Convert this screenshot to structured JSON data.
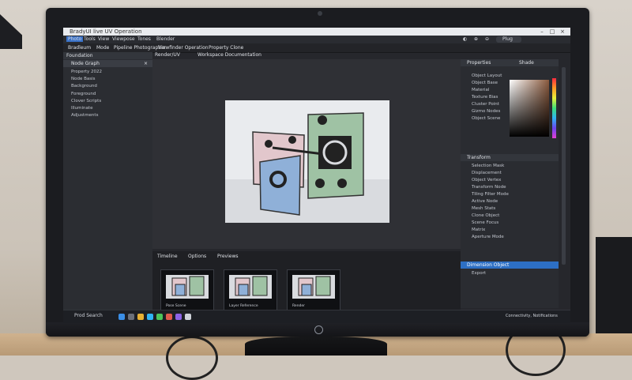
{
  "window": {
    "title": "BradyUI live UV Operation",
    "controls": [
      "–",
      "□",
      "×"
    ]
  },
  "menu": {
    "items": [
      "Photo",
      "Tools",
      "View",
      "Viewpose",
      "Tones",
      "Blender"
    ],
    "right_pills": [
      "◐",
      "⊕",
      "⊖",
      "Plug"
    ]
  },
  "toolbar": {
    "left_a": "Bradleum",
    "left_b": "Mode",
    "left_c": "Pipeline Photographer",
    "center_a": "Viewfinder Operation",
    "center_b": "Property Clone"
  },
  "left_panel": {
    "tab": "Foundation",
    "header": "Node Graph",
    "tree": [
      "Property 2022",
      "Node Basis",
      "Background",
      "Foreground",
      "Clover Scripts",
      "Illuminate",
      "Adjustments"
    ]
  },
  "viewport": {
    "tabs": [
      "Render/UV",
      "Workspace Documentation"
    ]
  },
  "thumbs": {
    "tabs": [
      "Timeline",
      "Options",
      "Previews"
    ],
    "items": [
      "Pose Scene",
      "Layer Reference",
      "Render"
    ]
  },
  "right_panel": {
    "header": "Properties",
    "color_tab": "Shade",
    "list": [
      "Object Layout",
      "Object Base",
      "Material",
      "Texture Bias",
      "Cluster Point",
      "Gizmo Nodes",
      "Object Scene"
    ],
    "lower_header": "Transform",
    "lower_list": [
      "Selection Mask",
      "Displacement",
      "Object Vertex",
      "Transform Node",
      "Tiling Filter Mode",
      "Active Node",
      "Mesh Stats",
      "Clone Object",
      "Scene Focus",
      "Matrix",
      "Aperture Mode"
    ],
    "selected": "Dimension Object",
    "after_selected": "Export"
  },
  "taskbar": {
    "search": "Prod Search",
    "tray": "Connectivity, Notifications",
    "icon_colors": [
      "#3a8ee6",
      "#6b6f78",
      "#e8b133",
      "#2fb4f5",
      "#4cc45a",
      "#e05a4c",
      "#8d63e6",
      "#cfd3da"
    ]
  },
  "colors": {
    "accent": "#2d6fc4",
    "panel": "#2b2d32",
    "scene_bg": "#e9ebee"
  }
}
